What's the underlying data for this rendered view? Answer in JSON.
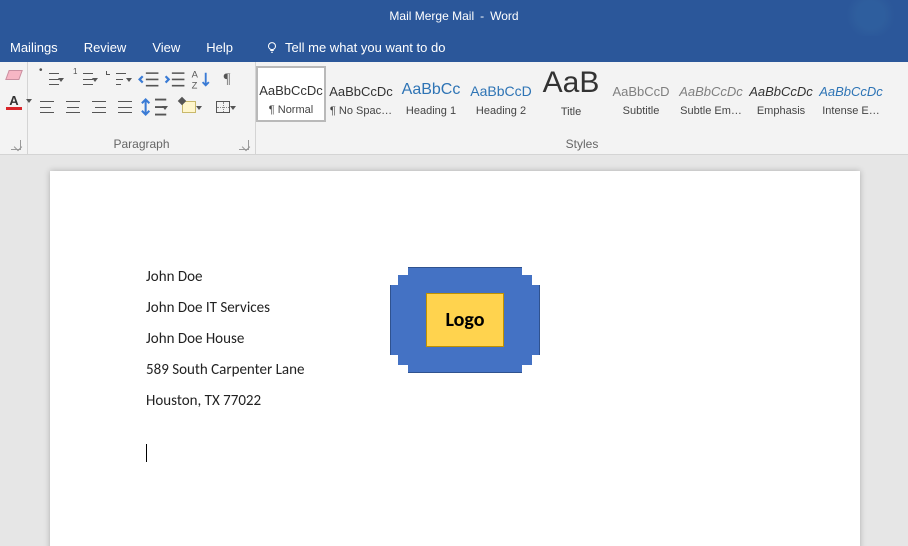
{
  "title": {
    "doc": "Mail Merge Mail",
    "sep": "-",
    "app": "Word"
  },
  "menu": {
    "mailings": "Mailings",
    "review": "Review",
    "view": "View",
    "help": "Help",
    "tellme": "Tell me what you want to do"
  },
  "ribbon": {
    "fontcolor_A": "A",
    "paragraph_label": "Paragraph",
    "pilcrow": "¶",
    "styles_label": "Styles",
    "styles": [
      {
        "sample": "AaBbCcDc",
        "name": "¶ Normal",
        "cls": "",
        "selected": true
      },
      {
        "sample": "AaBbCcDc",
        "name": "¶ No Spac…",
        "cls": "",
        "selected": false
      },
      {
        "sample": "AaBbCc",
        "name": "Heading 1",
        "cls": "blue h1",
        "selected": false
      },
      {
        "sample": "AaBbCcD",
        "name": "Heading 2",
        "cls": "blue h2",
        "selected": false
      },
      {
        "sample": "AaB",
        "name": "Title",
        "cls": "title",
        "selected": false
      },
      {
        "sample": "AaBbCcD",
        "name": "Subtitle",
        "cls": "gray sub",
        "selected": false
      },
      {
        "sample": "AaBbCcDc",
        "name": "Subtle Em…",
        "cls": "gray italic",
        "selected": false
      },
      {
        "sample": "AaBbCcDc",
        "name": "Emphasis",
        "cls": "italic",
        "selected": false
      },
      {
        "sample": "AaBbCcDc",
        "name": "Intense E…",
        "cls": "blue italic",
        "selected": false
      }
    ]
  },
  "doc": {
    "address": [
      "John Doe",
      "John Doe IT Services",
      "John Doe House",
      "589 South Carpenter Lane",
      "Houston, TX 77022"
    ],
    "logo_text": "Logo"
  }
}
